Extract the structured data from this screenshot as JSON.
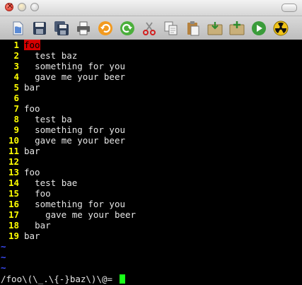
{
  "toolbar": {
    "icons": [
      "open-icon",
      "save-icon",
      "save-all-icon",
      "print-icon",
      "undo-icon",
      "redo-icon",
      "cut-icon",
      "copy-icon",
      "paste-icon",
      "load-session-icon",
      "save-session-icon",
      "run-icon",
      "make-icon"
    ]
  },
  "editor": {
    "lines": [
      {
        "num": "1",
        "indent": "",
        "text": "foo",
        "highlight": true
      },
      {
        "num": "2",
        "indent": "  ",
        "text": "test baz"
      },
      {
        "num": "3",
        "indent": "  ",
        "text": "something for you"
      },
      {
        "num": "4",
        "indent": "  ",
        "text": "gave me your beer"
      },
      {
        "num": "5",
        "indent": "",
        "text": "bar"
      },
      {
        "num": "6",
        "indent": "",
        "text": ""
      },
      {
        "num": "7",
        "indent": "",
        "text": "foo"
      },
      {
        "num": "8",
        "indent": "  ",
        "text": "test ba"
      },
      {
        "num": "9",
        "indent": "  ",
        "text": "something for you"
      },
      {
        "num": "10",
        "indent": "  ",
        "text": "gave me your beer"
      },
      {
        "num": "11",
        "indent": "",
        "text": "bar"
      },
      {
        "num": "12",
        "indent": "",
        "text": ""
      },
      {
        "num": "13",
        "indent": "",
        "text": "foo"
      },
      {
        "num": "14",
        "indent": "  ",
        "text": "test bae"
      },
      {
        "num": "15",
        "indent": "  ",
        "text": "foo"
      },
      {
        "num": "16",
        "indent": "  ",
        "text": "something for you"
      },
      {
        "num": "17",
        "indent": "    ",
        "text": "gave me your beer"
      },
      {
        "num": "18",
        "indent": "  ",
        "text": "bar"
      },
      {
        "num": "19",
        "indent": "",
        "text": "bar"
      }
    ],
    "tildes": [
      "~",
      "~",
      "~"
    ]
  },
  "command_line": {
    "text": "/foo\\(\\_.\\{-}baz\\)\\@= "
  },
  "colors": {
    "line_numbers": "#ffff00",
    "match_highlight": "#d50000",
    "cursor": "#19ff19",
    "tilde": "#3c4cff"
  }
}
